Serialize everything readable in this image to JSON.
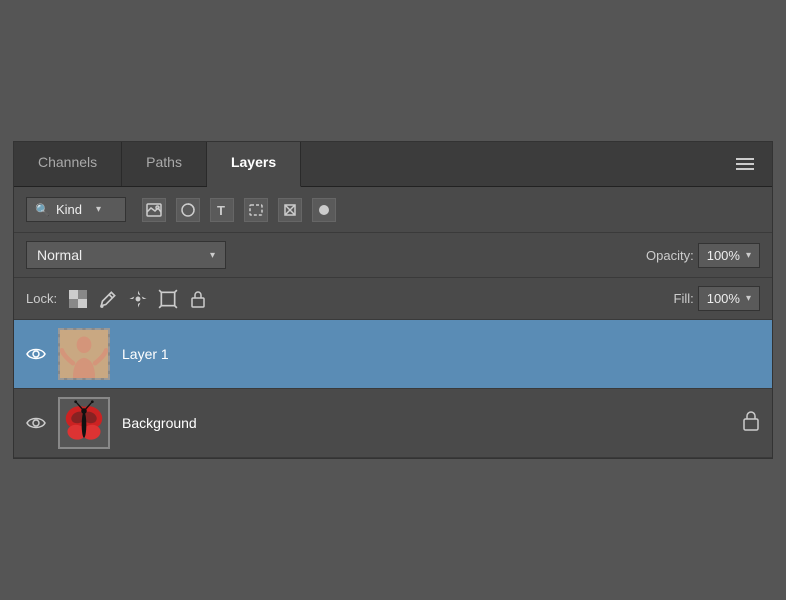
{
  "tabs": [
    {
      "id": "channels",
      "label": "Channels",
      "active": false
    },
    {
      "id": "paths",
      "label": "Paths",
      "active": false
    },
    {
      "id": "layers",
      "label": "Layers",
      "active": true
    }
  ],
  "filter": {
    "kind_label": "Kind",
    "icons": [
      "image",
      "circle",
      "text",
      "selection",
      "pixel",
      "dot"
    ]
  },
  "blend": {
    "mode": "Normal",
    "opacity_label": "Opacity:",
    "opacity_value": "100%",
    "fill_label": "Fill:",
    "fill_value": "100%"
  },
  "lock": {
    "label": "Lock:"
  },
  "layers": [
    {
      "id": "layer1",
      "name": "Layer 1",
      "selected": true,
      "visible": true,
      "locked": false,
      "thumb_type": "person"
    },
    {
      "id": "background",
      "name": "Background",
      "selected": false,
      "visible": true,
      "locked": true,
      "thumb_type": "butterfly"
    }
  ],
  "menu_icon": "≡"
}
